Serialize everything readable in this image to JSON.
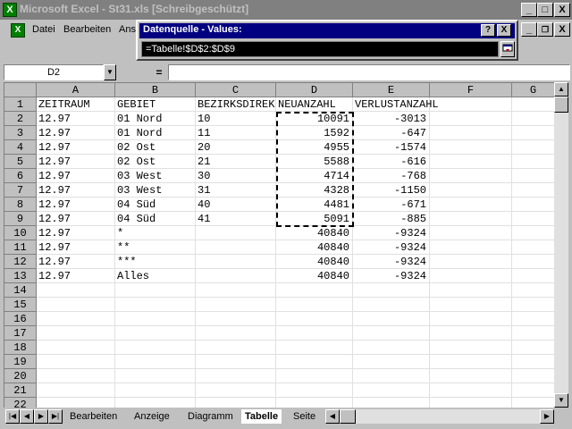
{
  "window": {
    "title": "Microsoft Excel - St31.xls  [Schreibgeschützt]",
    "minimize": "_",
    "maximize": "□",
    "close": "X",
    "doc_min": "_",
    "doc_restore": "❐",
    "doc_close": "X"
  },
  "menu": {
    "items": [
      "Datei",
      "Bearbeiten",
      "Ansi"
    ]
  },
  "dialog": {
    "title": "Datenquelle - Values:",
    "help": "?",
    "close": "X",
    "value": "=Tabelle!$D$2:$D$9"
  },
  "formula_bar": {
    "cell_ref": "D2",
    "eq": "="
  },
  "columns": [
    "A",
    "B",
    "C",
    "D",
    "E",
    "F",
    "G"
  ],
  "rows": [
    "1",
    "2",
    "3",
    "4",
    "5",
    "6",
    "7",
    "8",
    "9",
    "10",
    "11",
    "12",
    "13",
    "14",
    "15",
    "16",
    "17",
    "18",
    "19",
    "20",
    "21",
    "22"
  ],
  "table": {
    "header": [
      "ZEITRAUM",
      "GEBIET",
      "BEZIRKSDIREK",
      "NEUANZAHL",
      "VERLUSTANZAHL"
    ],
    "data": [
      [
        "12.97",
        "01 Nord",
        "10",
        "10091",
        "-3013"
      ],
      [
        "12.97",
        "01 Nord",
        "11",
        "1592",
        "-647"
      ],
      [
        "12.97",
        "02 Ost",
        "20",
        "4955",
        "-1574"
      ],
      [
        "12.97",
        "02 Ost",
        "21",
        "5588",
        "-616"
      ],
      [
        "12.97",
        "03 West",
        "30",
        "4714",
        "-768"
      ],
      [
        "12.97",
        "03 West",
        "31",
        "4328",
        "-1150"
      ],
      [
        "12.97",
        "04 Süd",
        "40",
        "4481",
        "-671"
      ],
      [
        "12.97",
        "04 Süd",
        "41",
        "5091",
        "-885"
      ],
      [
        "12.97",
        "*",
        "",
        "40840",
        "-9324"
      ],
      [
        "12.97",
        "**",
        "",
        "40840",
        "-9324"
      ],
      [
        "12.97",
        "***",
        "",
        "40840",
        "-9324"
      ],
      [
        "12.97",
        "Alles",
        "",
        "40840",
        "-9324"
      ]
    ]
  },
  "sheet_tabs": [
    {
      "label": "Bearbeiten",
      "active": false
    },
    {
      "label": "Anzeige",
      "active": false
    },
    {
      "label": "Diagramm",
      "active": false
    },
    {
      "label": "Tabelle",
      "active": true
    },
    {
      "label": "Seite",
      "active": false
    }
  ],
  "icons": {
    "app": "excel-icon",
    "nav_first": "|◀",
    "nav_prev": "◀",
    "nav_next": "▶",
    "nav_last": "▶|",
    "up": "▲",
    "down": "▼",
    "left": "◀",
    "right": "▶",
    "dropdown": "▼"
  },
  "colors": {
    "title_inactive": "#808080",
    "dialog_title": "#000080",
    "face": "#c0c0c0"
  }
}
